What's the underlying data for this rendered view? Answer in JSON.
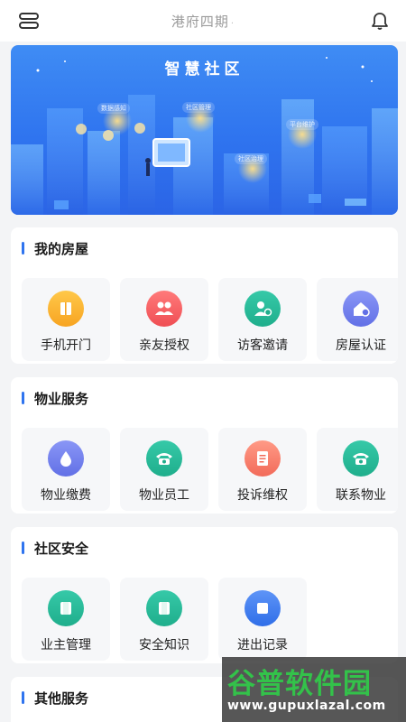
{
  "header": {
    "title": "港府四期",
    "title_suffix": "·"
  },
  "banner": {
    "title": "智慧社区",
    "tags": [
      "数据感知",
      "社区管理",
      "平台维护",
      "社区治理"
    ]
  },
  "sections": [
    {
      "title": "我的房屋",
      "items": [
        {
          "label": "手机开门",
          "icon": "door-icon",
          "color": "#f7a421"
        },
        {
          "label": "亲友授权",
          "icon": "people-icon",
          "color": "#ef4e54"
        },
        {
          "label": "访客邀请",
          "icon": "visitor-icon",
          "color": "#1fae8c"
        },
        {
          "label": "房屋认证",
          "icon": "house-check-icon",
          "color": "#6270e6"
        }
      ]
    },
    {
      "title": "物业服务",
      "items": [
        {
          "label": "物业缴费",
          "icon": "water-drop-icon",
          "color": "#6270e6"
        },
        {
          "label": "物业员工",
          "icon": "phone-icon",
          "color": "#1fae8c"
        },
        {
          "label": "投诉维权",
          "icon": "document-icon",
          "color": "#f26b5a"
        },
        {
          "label": "联系物业",
          "icon": "phone-icon",
          "color": "#1fae8c"
        }
      ]
    },
    {
      "title": "社区安全",
      "items": [
        {
          "label": "业主管理",
          "icon": "owner-icon",
          "color": "#1fae8c"
        },
        {
          "label": "安全知识",
          "icon": "book-icon",
          "color": "#1fae8c"
        },
        {
          "label": "进出记录",
          "icon": "record-icon",
          "color": "#2f6ee8"
        }
      ]
    },
    {
      "title": "其他服务",
      "items": []
    }
  ],
  "watermark": {
    "big": "谷普软件园",
    "small": "www.gupuxlazal.com"
  }
}
